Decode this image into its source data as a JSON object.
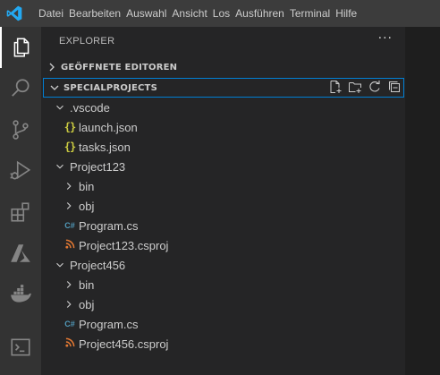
{
  "menu": [
    "Datei",
    "Bearbeiten",
    "Auswahl",
    "Ansicht",
    "Los",
    "Ausführen",
    "Terminal",
    "Hilfe"
  ],
  "explorer": {
    "title": "EXPLORER",
    "open_editors_title": "GEÖFFNETE EDITOREN",
    "folder_title": "SPECIALPROJECTS"
  },
  "tree": [
    {
      "label": ".vscode",
      "type": "folder",
      "expanded": true,
      "depth": 1
    },
    {
      "label": "launch.json",
      "type": "json",
      "depth": 2
    },
    {
      "label": "tasks.json",
      "type": "json",
      "depth": 2
    },
    {
      "label": "Project123",
      "type": "folder",
      "expanded": true,
      "depth": 1
    },
    {
      "label": "bin",
      "type": "folder",
      "expanded": false,
      "depth": 2
    },
    {
      "label": "obj",
      "type": "folder",
      "expanded": false,
      "depth": 2
    },
    {
      "label": "Program.cs",
      "type": "csharp",
      "depth": 2
    },
    {
      "label": "Project123.csproj",
      "type": "csproj",
      "depth": 2
    },
    {
      "label": "Project456",
      "type": "folder",
      "expanded": true,
      "depth": 1
    },
    {
      "label": "bin",
      "type": "folder",
      "expanded": false,
      "depth": 2
    },
    {
      "label": "obj",
      "type": "folder",
      "expanded": false,
      "depth": 2
    },
    {
      "label": "Program.cs",
      "type": "csharp",
      "depth": 2
    },
    {
      "label": "Project456.csproj",
      "type": "csproj",
      "depth": 2
    }
  ],
  "activity_icons": [
    "explorer-icon",
    "search-icon",
    "source-control-icon",
    "run-debug-icon",
    "extensions-icon",
    "azure-icon",
    "docker-icon",
    "terminal-icon"
  ],
  "colors": {
    "titlebar": "#3c3c3c",
    "activitybar": "#333333",
    "sidebar": "#252526",
    "focus_border": "#007fd4",
    "json": "#cbcb41",
    "csharp": "#519aba",
    "csproj": "#e37933"
  }
}
